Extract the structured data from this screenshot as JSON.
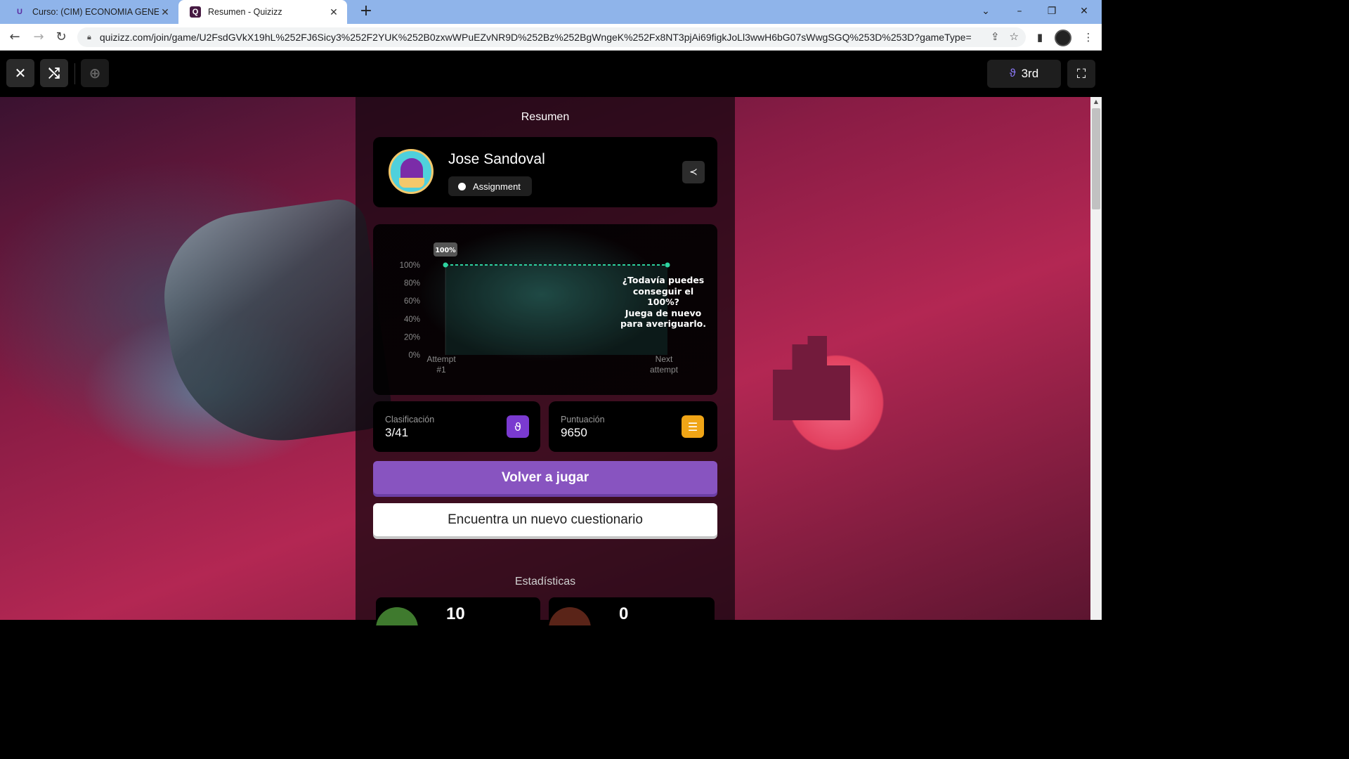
{
  "browser": {
    "tabs": [
      {
        "title": "Curso: (CIM) ECONOMIA GENERAL",
        "favicon": "u-logo-icon",
        "active": false
      },
      {
        "title": "Resumen - Quizizz",
        "favicon": "quizizz-icon",
        "active": true
      }
    ],
    "url": "quizizz.com/join/game/U2FsdGVkX19hL%252FJ6Sicy3%252F2YUK%252B0zxwWPuEZvNR9D%252Bz%252BgWngeK%252Fx8NT3pjAi69figkJoLl3wwH6bG07sWwgSGQ%253D%253D?gameType=asy..."
  },
  "topbar": {
    "rank_label": "3rd"
  },
  "summary": {
    "title": "Resumen",
    "player_name": "Jose Sandoval",
    "mode_label": "Assignment"
  },
  "chart_data": {
    "type": "line",
    "x": [
      "Attempt #1",
      "Next attempt"
    ],
    "series": [
      {
        "values": [
          100,
          100
        ]
      }
    ],
    "data_labels": [
      "100%"
    ],
    "y_ticks": [
      "100%",
      "80%",
      "60%",
      "40%",
      "20%",
      "0%"
    ],
    "ylim": [
      0,
      100
    ],
    "x_tick_lines": [
      [
        "Attempt",
        "#1"
      ],
      [
        "Next",
        "attempt"
      ]
    ],
    "note": [
      "¿Todavía puedes",
      "conseguir el 100%?",
      "Juega de nuevo",
      "para averiguarlo."
    ],
    "line_color": "#2ed3a0",
    "grid": false
  },
  "stats": {
    "rank_label": "Clasificación",
    "rank_value": "3/41",
    "score_label": "Puntuación",
    "score_value": "9650"
  },
  "buttons": {
    "play_again": "Volver a jugar",
    "find_quiz": "Encuentra un nuevo cuestionario"
  },
  "statistics": {
    "title": "Estadísticas",
    "correct": "10",
    "incorrect": "0"
  },
  "colors": {
    "accent": "#8854c0",
    "rank_icon": "#7a3ad0",
    "score_icon": "#f0a516",
    "line": "#2ed3a0"
  }
}
